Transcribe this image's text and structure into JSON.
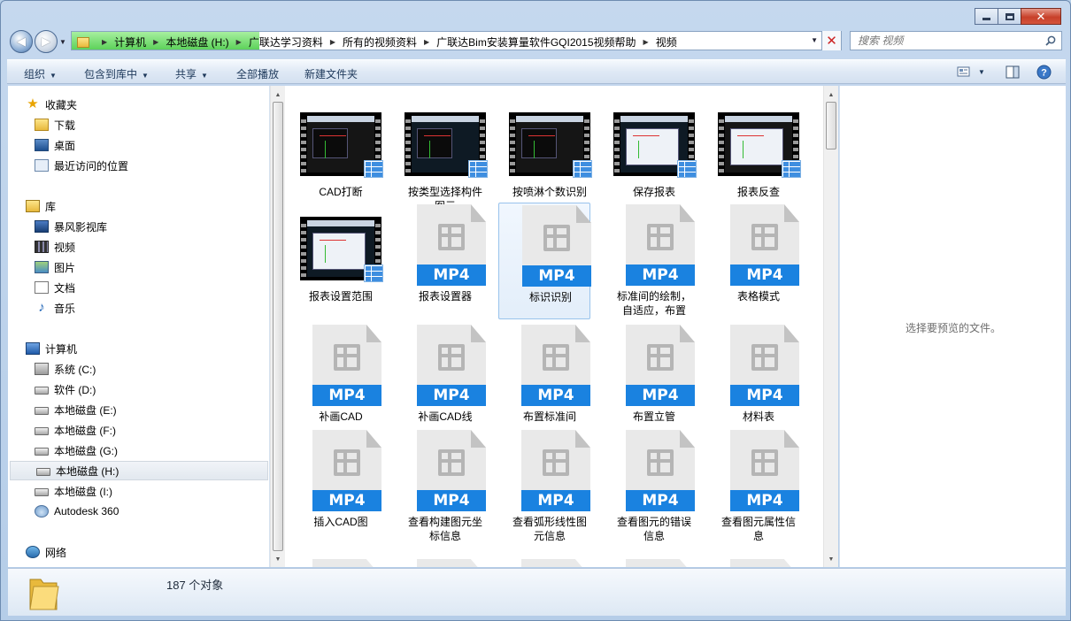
{
  "window": {
    "title": "视频"
  },
  "address": {
    "crumbs": [
      "计算机",
      "本地磁盘 (H:)",
      "广联达学习资料",
      "所有的视频资料",
      "广联达Bim安装算量软件GQI2015视频帮助",
      "视频"
    ]
  },
  "search": {
    "placeholder": "搜索 视频"
  },
  "toolbar": {
    "organize": "组织",
    "include_library": "包含到库中",
    "share": "共享",
    "play_all": "全部播放",
    "new_folder": "新建文件夹"
  },
  "nav": {
    "favorites": {
      "label": "收藏夹",
      "items": [
        "下载",
        "桌面",
        "最近访问的位置"
      ]
    },
    "libraries": {
      "label": "库",
      "items": [
        "暴风影视库",
        "视频",
        "图片",
        "文档",
        "音乐"
      ]
    },
    "computer": {
      "label": "计算机",
      "items": [
        "系统 (C:)",
        "软件 (D:)",
        "本地磁盘 (E:)",
        "本地磁盘 (F:)",
        "本地磁盘 (G:)",
        "本地磁盘 (H:)",
        "本地磁盘 (I:)",
        "Autodesk 360"
      ],
      "selected": "本地磁盘 (H:)"
    },
    "network": {
      "label": "网络"
    }
  },
  "files": [
    {
      "name": "CAD打断",
      "kind": "video"
    },
    {
      "name": "按类型选择构件图元",
      "kind": "video"
    },
    {
      "name": "按喷淋个数识别",
      "kind": "video"
    },
    {
      "name": "保存报表",
      "kind": "video"
    },
    {
      "name": "报表反查",
      "kind": "video"
    },
    {
      "name": "报表设置范围",
      "kind": "video"
    },
    {
      "name": "报表设置器",
      "kind": "mp4"
    },
    {
      "name": "标识识别",
      "kind": "mp4",
      "selected": true
    },
    {
      "name": "标准间的绘制，自适应，布置",
      "kind": "mp4"
    },
    {
      "name": "表格模式",
      "kind": "mp4"
    },
    {
      "name": "补画CAD",
      "kind": "mp4"
    },
    {
      "name": "补画CAD线",
      "kind": "mp4"
    },
    {
      "name": "布置标准间",
      "kind": "mp4"
    },
    {
      "name": "布置立管",
      "kind": "mp4"
    },
    {
      "name": "材料表",
      "kind": "mp4"
    },
    {
      "name": "插入CAD图",
      "kind": "mp4"
    },
    {
      "name": "查看构建图元坐标信息",
      "kind": "mp4"
    },
    {
      "name": "查看弧形线性图元信息",
      "kind": "mp4"
    },
    {
      "name": "查看图元的错误信息",
      "kind": "mp4"
    },
    {
      "name": "查看图元属性信息",
      "kind": "mp4"
    }
  ],
  "file_badge": "MP4",
  "preview": {
    "text": "选择要预览的文件。"
  },
  "status": {
    "count_text": "187 个对象"
  },
  "colors": {
    "accent": "#1a82e0",
    "selection": "#99c3ec",
    "address_progress": "#5dd25a"
  }
}
